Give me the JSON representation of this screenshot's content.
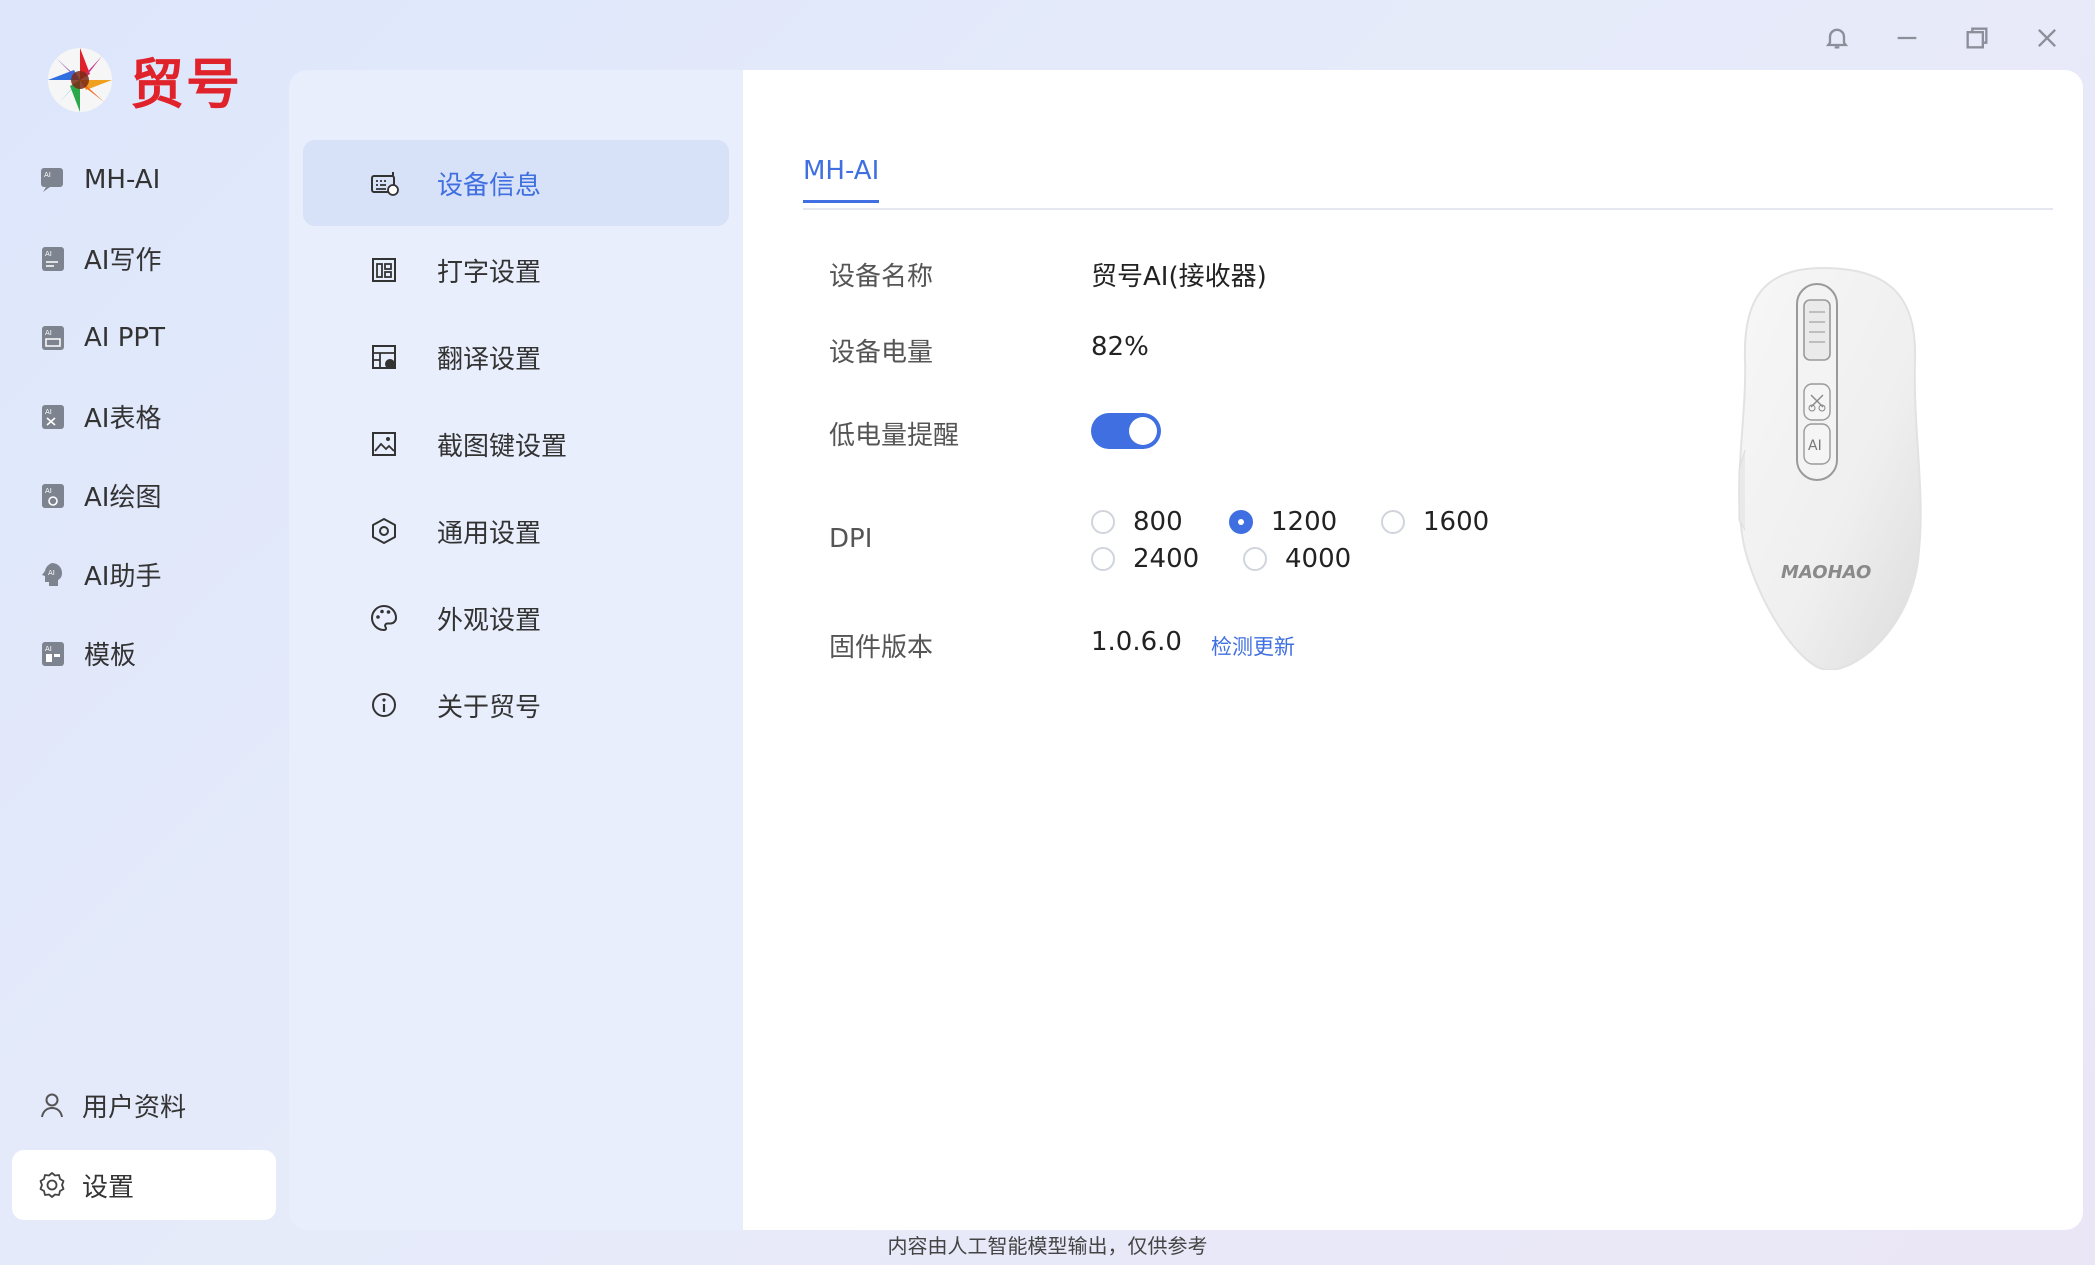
{
  "app": {
    "name": "贸号"
  },
  "window_controls": [
    "bell-icon",
    "minimize-icon",
    "restore-icon",
    "close-icon"
  ],
  "left_nav": [
    {
      "label": "MH-AI",
      "icon": "mh-ai-icon"
    },
    {
      "label": "AI写作",
      "icon": "ai-writing-icon"
    },
    {
      "label": "AI PPT",
      "icon": "ai-ppt-icon"
    },
    {
      "label": "AI表格",
      "icon": "ai-table-icon"
    },
    {
      "label": "AI绘图",
      "icon": "ai-drawing-icon"
    },
    {
      "label": "AI助手",
      "icon": "ai-assistant-icon"
    },
    {
      "label": "模板",
      "icon": "template-icon"
    }
  ],
  "bottom_nav": [
    {
      "label": "用户资料",
      "icon": "user-icon"
    },
    {
      "label": "设置",
      "icon": "settings-gear-icon",
      "active": true
    }
  ],
  "settings_menu": [
    {
      "label": "设备信息",
      "icon": "device-info-icon",
      "active": true
    },
    {
      "label": "打字设置",
      "icon": "typing-icon"
    },
    {
      "label": "翻译设置",
      "icon": "translate-icon"
    },
    {
      "label": "截图键设置",
      "icon": "screenshot-icon"
    },
    {
      "label": "通用设置",
      "icon": "general-settings-icon"
    },
    {
      "label": "外观设置",
      "icon": "palette-icon"
    },
    {
      "label": "关于贸号",
      "icon": "info-icon"
    }
  ],
  "content": {
    "tab": "MH-AI",
    "device_name_label": "设备名称",
    "device_name_value": "贸号AI(接收器)",
    "battery_label": "设备电量",
    "battery_value": "82%",
    "low_battery_label": "低电量提醒",
    "low_battery_enabled": true,
    "dpi_label": "DPI",
    "dpi_options": [
      "800",
      "1200",
      "1600",
      "2400",
      "4000"
    ],
    "dpi_selected": "1200",
    "firmware_label": "固件版本",
    "firmware_value": "1.0.6.0",
    "check_update": "检测更新",
    "mouse_brand": "MAOHAO",
    "mouse_button_label": "AI"
  },
  "footer": "内容由人工智能模型输出，仅供参考",
  "colors": {
    "accent": "#3f6fe0",
    "brand_red": "#e0232b"
  }
}
